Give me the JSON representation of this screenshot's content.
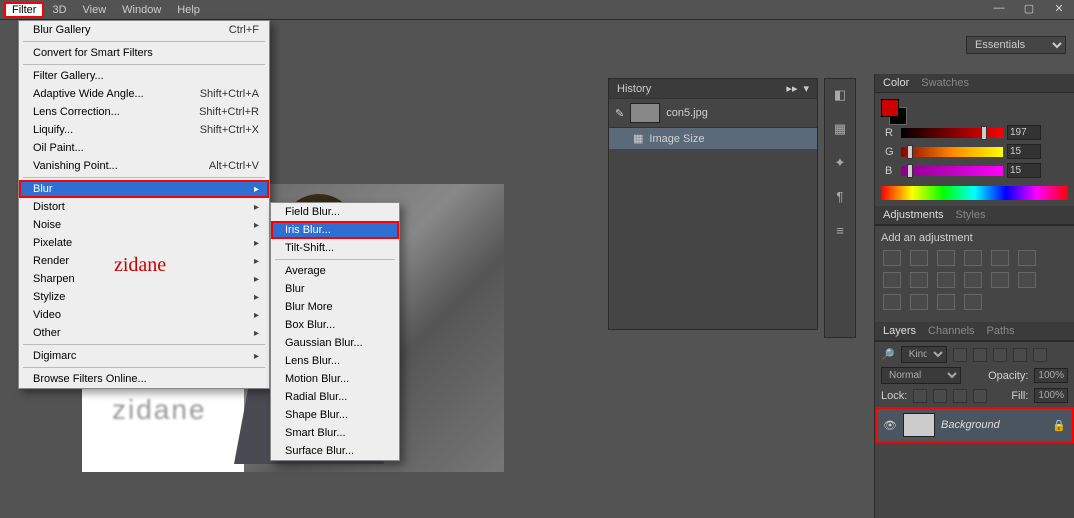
{
  "menubar": {
    "items": [
      "Filter",
      "3D",
      "View",
      "Window",
      "Help"
    ]
  },
  "window_controls": {
    "min": "—",
    "max": "▢",
    "close": "✕"
  },
  "workspace_selector": "Essentials",
  "filter_menu": {
    "groups": [
      [
        {
          "label": "Blur Gallery",
          "shortcut": "Ctrl+F"
        }
      ],
      [
        {
          "label": "Convert for Smart Filters"
        }
      ],
      [
        {
          "label": "Filter Gallery..."
        },
        {
          "label": "Adaptive Wide Angle...",
          "shortcut": "Shift+Ctrl+A"
        },
        {
          "label": "Lens Correction...",
          "shortcut": "Shift+Ctrl+R"
        },
        {
          "label": "Liquify...",
          "shortcut": "Shift+Ctrl+X"
        },
        {
          "label": "Oil Paint..."
        },
        {
          "label": "Vanishing Point...",
          "shortcut": "Alt+Ctrl+V"
        }
      ],
      [
        {
          "label": "Blur",
          "sub": true,
          "selected": true
        },
        {
          "label": "Distort",
          "sub": true
        },
        {
          "label": "Noise",
          "sub": true
        },
        {
          "label": "Pixelate",
          "sub": true
        },
        {
          "label": "Render",
          "sub": true
        },
        {
          "label": "Sharpen",
          "sub": true
        },
        {
          "label": "Stylize",
          "sub": true
        },
        {
          "label": "Video",
          "sub": true
        },
        {
          "label": "Other",
          "sub": true
        }
      ],
      [
        {
          "label": "Digimarc",
          "sub": true
        }
      ],
      [
        {
          "label": "Browse Filters Online..."
        }
      ]
    ]
  },
  "blur_submenu": {
    "groups": [
      [
        {
          "label": "Field Blur..."
        },
        {
          "label": "Iris Blur...",
          "selected": true
        },
        {
          "label": "Tilt-Shift..."
        }
      ],
      [
        {
          "label": "Average"
        },
        {
          "label": "Blur"
        },
        {
          "label": "Blur More"
        },
        {
          "label": "Box Blur..."
        },
        {
          "label": "Gaussian Blur..."
        },
        {
          "label": "Lens Blur..."
        },
        {
          "label": "Motion Blur..."
        },
        {
          "label": "Radial Blur..."
        },
        {
          "label": "Shape Blur..."
        },
        {
          "label": "Smart Blur..."
        },
        {
          "label": "Surface Blur..."
        }
      ]
    ]
  },
  "annotation": "zidane",
  "canvas_text": "zidane",
  "history": {
    "title": "History",
    "rows": [
      {
        "label": "con5.jpg"
      },
      {
        "label": "Image Size",
        "selected": true
      }
    ]
  },
  "color": {
    "tabs": [
      "Color",
      "Swatches"
    ],
    "r": "197",
    "g": "15",
    "b": "15"
  },
  "adjustments": {
    "tabs": [
      "Adjustments",
      "Styles"
    ],
    "heading": "Add an adjustment"
  },
  "layers": {
    "tabs": [
      "Layers",
      "Channels",
      "Paths"
    ],
    "kind": "Kind",
    "blend": "Normal",
    "opacity_label": "Opacity:",
    "opacity": "100%",
    "lock_label": "Lock:",
    "fill_label": "Fill:",
    "fill": "100%",
    "layer_name": "Background"
  }
}
